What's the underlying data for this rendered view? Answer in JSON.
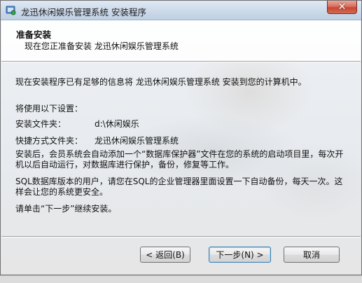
{
  "window": {
    "title": "龙迅休闲娱乐管理系统 安装程序",
    "close_symbol": "✕"
  },
  "header": {
    "title": "准备安装",
    "subtitle": "现在您正准备安装 龙迅休闲娱乐管理系统"
  },
  "body": {
    "intro": "现在安装程序已有足够的信息将 龙迅休闲娱乐管理系统 安装到您的计算机中。",
    "settings_heading": "将使用以下设置：",
    "install_folder_label": "安装文件夹：",
    "install_folder_value": "d:\\休闲娱乐",
    "shortcut_folder_label": "快捷方式文件夹：",
    "shortcut_folder_value": "龙迅休闲娱乐管理系统",
    "note1": "安装后，会员系统会自动添加一个“数据库保护器”文件在您的系统的启动项目里，每次开机以后自动运行，对数据库进行保护，备份，修复等工作。",
    "note2": "SQL数据库版本的用户，请您在SQL的企业管理器里面设置一下自动备份，每天一次。这样会让您的系统更安全。",
    "instruction": "请单击“下一步”继续安装。"
  },
  "buttons": {
    "back": "< 返回(B)",
    "next": "下一步(N) >",
    "cancel": "取消"
  }
}
